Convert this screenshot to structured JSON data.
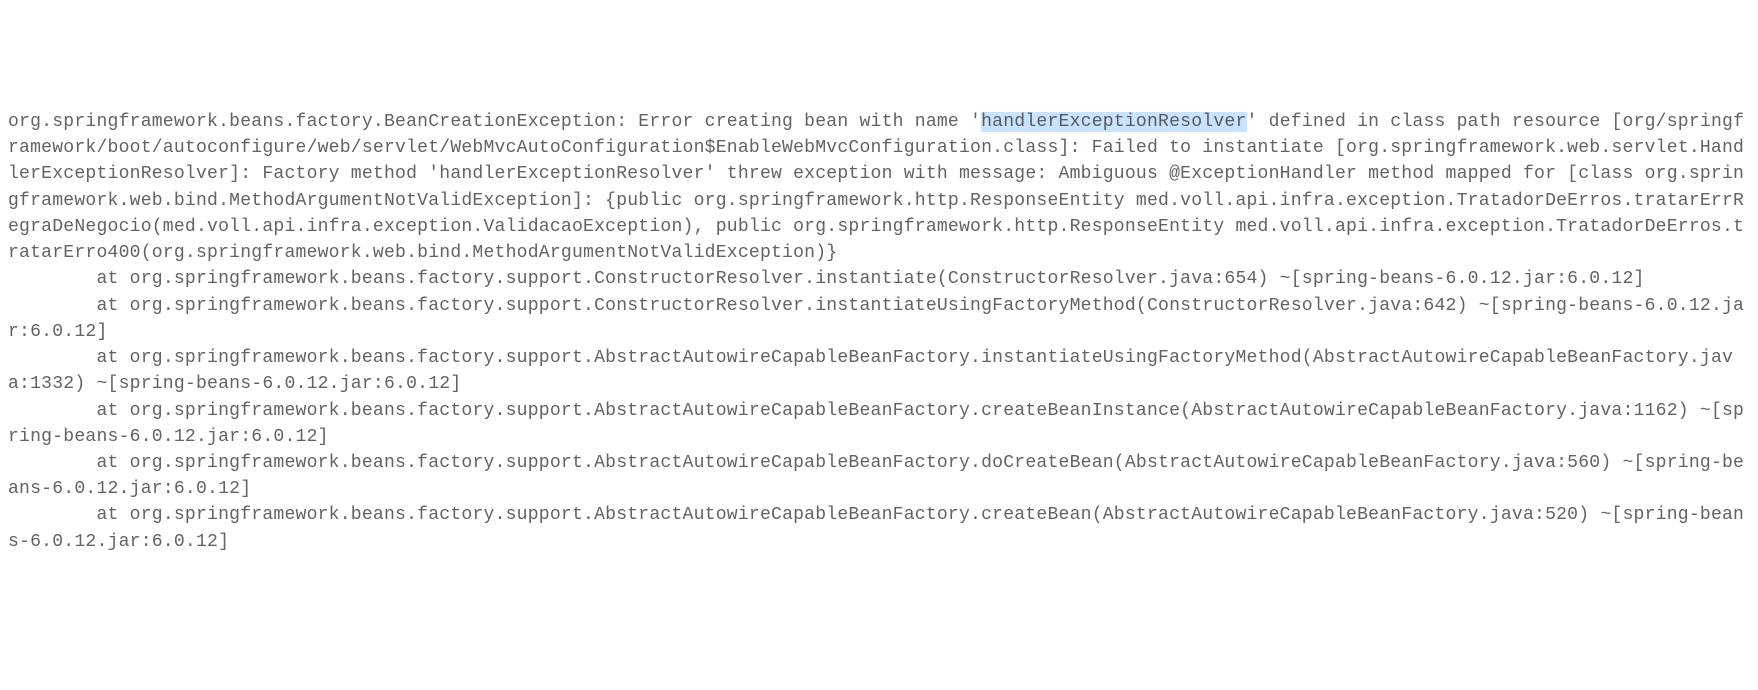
{
  "trace": {
    "pre_hl": "org.springframework.beans.factory.BeanCreationException: Error creating bean with name '",
    "hl": "handlerExceptionResolver",
    "post_hl": "' defined in class path resource [org/springframework/boot/autoconfigure/web/servlet/WebMvcAutoConfiguration$EnableWebMvcConfiguration.class]: Failed to instantiate [org.springframework.web.servlet.HandlerExceptionResolver]: Factory method 'handlerExceptionResolver' threw exception with message: Ambiguous @ExceptionHandler method mapped for [class org.springframework.web.bind.MethodArgumentNotValidException]: {public org.springframework.http.ResponseEntity med.voll.api.infra.exception.TratadorDeErros.tratarErrRegraDeNegocio(med.voll.api.infra.exception.ValidacaoException), public org.springframework.http.ResponseEntity med.voll.api.infra.exception.TratadorDeErros.tratarErro400(org.springframework.web.bind.MethodArgumentNotValidException)}\n        at org.springframework.beans.factory.support.ConstructorResolver.instantiate(ConstructorResolver.java:654) ~[spring-beans-6.0.12.jar:6.0.12]\n        at org.springframework.beans.factory.support.ConstructorResolver.instantiateUsingFactoryMethod(ConstructorResolver.java:642) ~[spring-beans-6.0.12.jar:6.0.12]\n        at org.springframework.beans.factory.support.AbstractAutowireCapableBeanFactory.instantiateUsingFactoryMethod(AbstractAutowireCapableBeanFactory.java:1332) ~[spring-beans-6.0.12.jar:6.0.12]\n        at org.springframework.beans.factory.support.AbstractAutowireCapableBeanFactory.createBeanInstance(AbstractAutowireCapableBeanFactory.java:1162) ~[spring-beans-6.0.12.jar:6.0.12]\n        at org.springframework.beans.factory.support.AbstractAutowireCapableBeanFactory.doCreateBean(AbstractAutowireCapableBeanFactory.java:560) ~[spring-beans-6.0.12.jar:6.0.12]\n        at org.springframework.beans.factory.support.AbstractAutowireCapableBeanFactory.createBean(AbstractAutowireCapableBeanFactory.java:520) ~[spring-beans-6.0.12.jar:6.0.12]"
  }
}
